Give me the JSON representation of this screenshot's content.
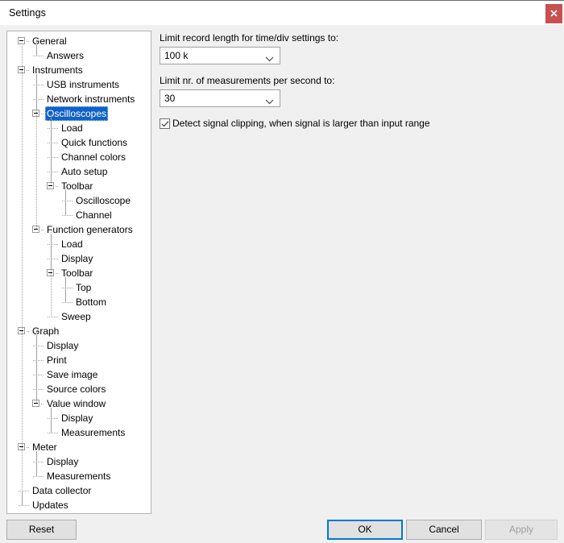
{
  "window": {
    "title": "Settings",
    "close_icon": "close-icon",
    "close_color": "#c9504f"
  },
  "tree": {
    "selected": "Oscilloscopes",
    "items": [
      {
        "label": "General",
        "level": 0,
        "expander": "collapse"
      },
      {
        "label": "Answers",
        "level": 1,
        "expander": "none"
      },
      {
        "label": "Instruments",
        "level": 0,
        "expander": "collapse"
      },
      {
        "label": "USB instruments",
        "level": 1,
        "expander": "none"
      },
      {
        "label": "Network instruments",
        "level": 1,
        "expander": "none"
      },
      {
        "label": "Oscilloscopes",
        "level": 1,
        "expander": "collapse"
      },
      {
        "label": "Load",
        "level": 2,
        "expander": "none"
      },
      {
        "label": "Quick functions",
        "level": 2,
        "expander": "none"
      },
      {
        "label": "Channel colors",
        "level": 2,
        "expander": "none"
      },
      {
        "label": "Auto setup",
        "level": 2,
        "expander": "none"
      },
      {
        "label": "Toolbar",
        "level": 2,
        "expander": "collapse"
      },
      {
        "label": "Oscilloscope",
        "level": 3,
        "expander": "none"
      },
      {
        "label": "Channel",
        "level": 3,
        "expander": "none"
      },
      {
        "label": "Function generators",
        "level": 1,
        "expander": "collapse"
      },
      {
        "label": "Load",
        "level": 2,
        "expander": "none"
      },
      {
        "label": "Display",
        "level": 2,
        "expander": "none"
      },
      {
        "label": "Toolbar",
        "level": 2,
        "expander": "collapse"
      },
      {
        "label": "Top",
        "level": 3,
        "expander": "none"
      },
      {
        "label": "Bottom",
        "level": 3,
        "expander": "none"
      },
      {
        "label": "Sweep",
        "level": 2,
        "expander": "none"
      },
      {
        "label": "Graph",
        "level": 0,
        "expander": "collapse"
      },
      {
        "label": "Display",
        "level": 1,
        "expander": "none"
      },
      {
        "label": "Print",
        "level": 1,
        "expander": "none"
      },
      {
        "label": "Save image",
        "level": 1,
        "expander": "none"
      },
      {
        "label": "Source colors",
        "level": 1,
        "expander": "none"
      },
      {
        "label": "Value window",
        "level": 1,
        "expander": "collapse"
      },
      {
        "label": "Display",
        "level": 2,
        "expander": "none"
      },
      {
        "label": "Measurements",
        "level": 2,
        "expander": "none"
      },
      {
        "label": "Meter",
        "level": 0,
        "expander": "collapse"
      },
      {
        "label": "Display",
        "level": 1,
        "expander": "none"
      },
      {
        "label": "Measurements",
        "level": 1,
        "expander": "none"
      },
      {
        "label": "Data collector",
        "level": 0,
        "expander": "none"
      },
      {
        "label": "Updates",
        "level": 0,
        "expander": "none"
      }
    ]
  },
  "content": {
    "record_length": {
      "label": "Limit record length for time/div settings to:",
      "value": "100 k",
      "arrow_icon": "chevron-down-icon"
    },
    "measurements_rate": {
      "label": "Limit nr. of measurements per second to:",
      "value": "30",
      "arrow_icon": "chevron-down-icon"
    },
    "clipping": {
      "label": "Detect signal clipping, when signal is larger than input range",
      "checked": true,
      "check_icon": "checkmark-icon"
    }
  },
  "buttons": {
    "reset": "Reset",
    "ok": "OK",
    "cancel": "Cancel",
    "apply": "Apply",
    "focus_color": "#0078d7"
  }
}
